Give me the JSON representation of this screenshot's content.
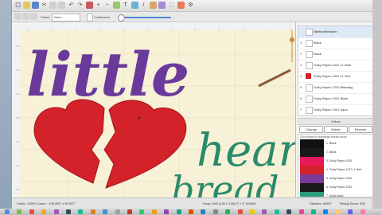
{
  "toolbar": {
    "field_label": "Select",
    "field_value": "None",
    "checkbox_label": "Continuous"
  },
  "canvas": {
    "text_line1": "little",
    "text_line2": "hear",
    "text_line3": "bread",
    "colors": {
      "background": "#f7f1d8",
      "purple": "#6a3a9a",
      "red": "#d4222a",
      "teal": "#2a8a6a",
      "accent": "#8a5a3a"
    }
  },
  "status": {
    "left": "Fabric: 100%  Cursor: -159.999\" x 59.907\"",
    "middle": "Hoop: 5X5 (130 x 130)   5\" x 4\" (5X5H)",
    "stitches": "Stitches: 46997",
    "right": "Ready  Zoom: 400"
  },
  "objects": {
    "items": [
      {
        "num": "",
        "label": "littleheartbreaker",
        "swatch": "#ffffff"
      },
      {
        "num": "1",
        "label": "Black",
        "swatch": "#ffffff"
      },
      {
        "num": "2",
        "label": "Black",
        "swatch": "#ffffff"
      },
      {
        "num": "3",
        "label": "Sulky Rayon 1001 Lt. Blue",
        "swatch": "#ffffff"
      },
      {
        "num": "4",
        "label": "Sulky Rayon 1001 Lt. Red",
        "swatch": "#d4222a"
      },
      {
        "num": "5",
        "label": "Sulky Rayon 1230 Bleeding",
        "swatch": "#ffffff"
      },
      {
        "num": "6",
        "label": "Sulky Rayon 1001 Black",
        "swatch": "#ffffff"
      },
      {
        "num": "7",
        "label": "Sulky Rayon 1001 Aqua",
        "swatch": "#ffffff"
      }
    ]
  },
  "colors_panel": {
    "header": "Colors",
    "buttons": [
      "Change",
      "Delete",
      "Reorder"
    ],
    "note": "Click below to rearrange thread colors",
    "swatches": [
      {
        "label": "1. Black",
        "color": "#111111"
      },
      {
        "label": "2. Black",
        "color": "#1a1a1a"
      },
      {
        "label": "3. Sulky Rayon 1029",
        "color": "#e8185a"
      },
      {
        "label": "4. Sulky Rayon 1147 Lt. Red",
        "color": "#d4222a"
      },
      {
        "label": "5. Sulky Rayon 1230",
        "color": "#7a3a9a"
      },
      {
        "label": "6. Sulky Rayon 1001",
        "color": "#1a1a1a"
      },
      {
        "label": "7. Sulky Aqua",
        "color": "#2a9a7a"
      }
    ]
  },
  "dock_colors": [
    "#4a90e2",
    "#7bc043",
    "#e94e3c",
    "#f5a623",
    "#9b59b6",
    "#34495e",
    "#1abc9c",
    "#e67e22",
    "#3498db",
    "#95a5a6",
    "#c0392b",
    "#2ecc71",
    "#f39c12",
    "#8e44ad",
    "#16a085",
    "#d35400",
    "#2980b9",
    "#7f8c8d",
    "#27ae60",
    "#e74c3c",
    "#f1c40f",
    "#9b59b6",
    "#1abc9c",
    "#34495e",
    "#e84393",
    "#00b894",
    "#0984e3",
    "#fdcb6e",
    "#6c5ce7",
    "#fd79a8"
  ]
}
